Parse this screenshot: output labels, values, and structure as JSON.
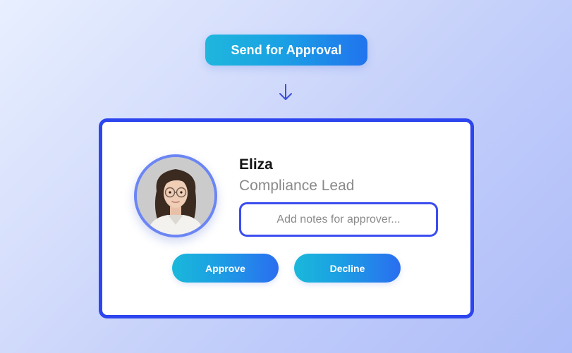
{
  "header": {
    "send_button_label": "Send for Approval",
    "arrow_icon": "arrow-down-icon"
  },
  "card": {
    "approver_name": "Eliza",
    "approver_role": "Compliance Lead",
    "notes_placeholder": "Add notes for approver...",
    "notes_value": "",
    "approve_label": "Approve",
    "decline_label": "Decline"
  },
  "colors": {
    "accent_blue": "#2d45ee",
    "button_gradient_start": "#1fb6dc",
    "button_gradient_end": "#2174ee",
    "name_text": "#141414",
    "role_text": "#8a8a8a"
  }
}
